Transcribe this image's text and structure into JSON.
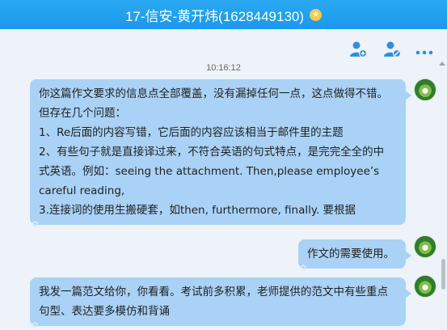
{
  "window": {
    "title": "17-信安-黄开炜(1628449130)",
    "title_badge": "★",
    "accent_color": "#1a99ea"
  },
  "toolbar": {
    "icons": [
      "add-member-icon",
      "remove-member-icon",
      "more-icon"
    ]
  },
  "chat": {
    "timestamp": "10:16:12",
    "messages": [
      {
        "sender": "other",
        "lines": [
          "你这篇作文要求的信息点全部覆盖，没有漏掉任何一点，这点做得不错。",
          "但存在几个问题：",
          "1、Re后面的内容写错，它后面的内容应该相当于邮件里的主题",
          "2、有些句子就是直接译过来，不符合英语的句式特点，是完完全全的中",
          "式英语。例如：seeing the attachment. Then,please employee’s",
          "careful reading,",
          "3.连接词的使用生搬硬套，如then, furthermore, finally. 要根据"
        ]
      },
      {
        "sender": "self",
        "lines": [
          "作文的需要使用。"
        ]
      },
      {
        "sender": "other",
        "lines": [
          "我发一篇范文给你，你看看。考试前多积累，老师提供的范文中有些重点",
          "句型、表达要多模仿和背诵"
        ]
      }
    ],
    "bubble_color": "#a9d2f6"
  }
}
